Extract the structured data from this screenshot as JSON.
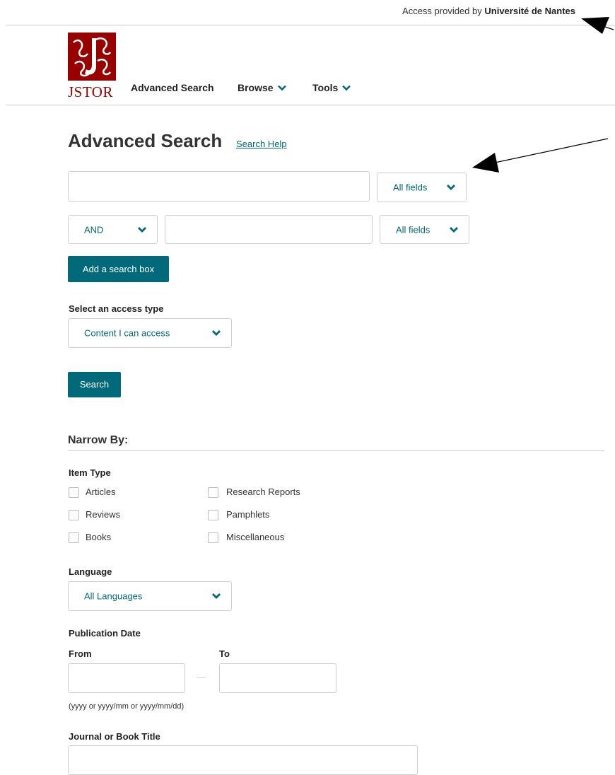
{
  "access": {
    "prefix": "Access provided by",
    "institution": "Université de Nantes"
  },
  "logo": {
    "word": "JSTOR"
  },
  "nav": {
    "advanced_search": "Advanced Search",
    "browse": "Browse",
    "tools": "Tools"
  },
  "page": {
    "title": "Advanced Search",
    "help": "Search Help"
  },
  "search": {
    "row1_field": "All fields",
    "row2_operator": "AND",
    "row2_field": "All fields",
    "add_box": "Add a search box"
  },
  "access_type": {
    "label": "Select an access type",
    "value": "Content I can access"
  },
  "search_button": "Search",
  "narrow": {
    "title": "Narrow By:",
    "item_type": {
      "label": "Item Type",
      "items": [
        "Articles",
        "Research Reports",
        "Reviews",
        "Pamphlets",
        "Books",
        "Miscellaneous"
      ]
    },
    "language": {
      "label": "Language",
      "value": "All Languages"
    },
    "pub_date": {
      "label": "Publication Date",
      "from": "From",
      "to": "To",
      "separator": "—",
      "hint": "(yyyy or yyyy/mm or yyyy/mm/dd)"
    },
    "journal_title": {
      "label": "Journal or Book Title"
    }
  },
  "colors": {
    "accent": "#006a7a",
    "brand": "#990000"
  }
}
